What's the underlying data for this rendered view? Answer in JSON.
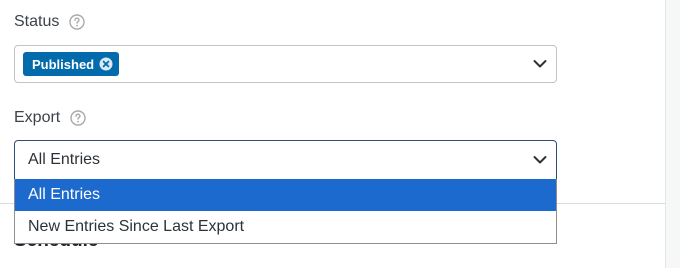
{
  "status": {
    "label": "Status",
    "help_icon": "question-circle-icon",
    "chip_label": "Published",
    "chip_remove_icon": "remove-x-icon",
    "chevron_icon": "chevron-down-icon"
  },
  "export": {
    "label": "Export",
    "help_icon": "question-circle-icon",
    "selected_value": "All Entries",
    "chevron_icon": "chevron-down-icon",
    "options": [
      {
        "label": "All Entries",
        "highlighted": true
      },
      {
        "label": "New Entries Since Last Export",
        "highlighted": false
      }
    ]
  },
  "schedule": {
    "heading": "Schedule"
  },
  "colors": {
    "chip_bg": "#036aab",
    "highlight_bg": "#1d6acf",
    "focus_border": "#2d4f7a"
  }
}
